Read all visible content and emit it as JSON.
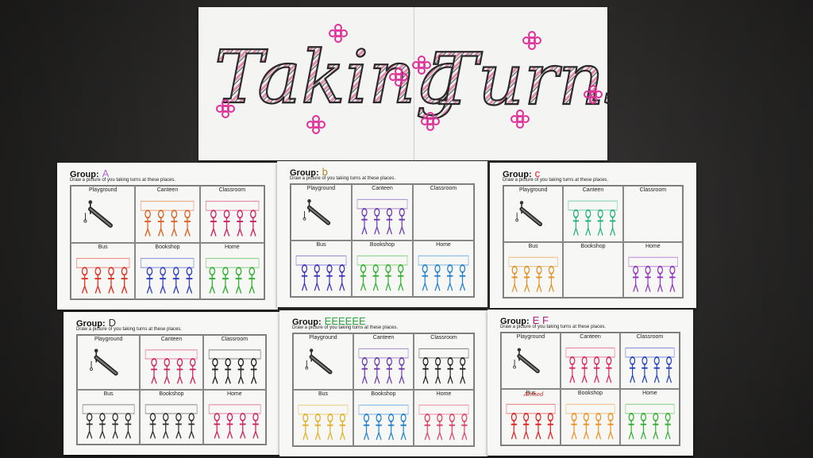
{
  "banner": {
    "title_word1": "Taking",
    "title_word2": "Turns"
  },
  "instruction": "Draw a picture of you taking turns at these places.",
  "group_label": "Group:",
  "places": [
    "Playground",
    "Canteen",
    "Classroom",
    "Bus",
    "Bookshop",
    "Home"
  ],
  "sheets": [
    {
      "group": "A",
      "mark_color": "#b06ad8",
      "drawings": {
        "Canteen": "#e06020",
        "Classroom": "#d02060",
        "Bus": "#e03020",
        "Bookshop": "#3040c0",
        "Home": "#30b030"
      }
    },
    {
      "group": "b",
      "mark_color": "#b08030",
      "drawings": {
        "Canteen": "#6a3ab0",
        "Bus": "#3a30c0",
        "Bookshop": "#30b030",
        "Home": "#2080d0"
      }
    },
    {
      "group": "c",
      "mark_color": "#e02020",
      "drawings": {
        "Canteen": "#20b080",
        "Bus": "#e09020",
        "Home": "#9030c0"
      }
    },
    {
      "group": "D",
      "mark_color": "#333333",
      "drawings": {
        "Canteen": "#d02060",
        "Classroom": "#202020",
        "Bus": "#303030",
        "Bookshop": "#303030",
        "Home": "#d02060"
      }
    },
    {
      "group": "EEEEEE",
      "mark_color": "#30a040",
      "drawings": {
        "Canteen": "#6a3ab0",
        "Classroom": "#202020",
        "Bus": "#e0b020",
        "Bookshop": "#2080d0",
        "Home": "#e04060"
      }
    },
    {
      "group": "E F",
      "mark_color": "#b02080",
      "drawings": {
        "Canteen": "#e02060",
        "Classroom": "#2040c0",
        "Bus": "#e02020",
        "Bookshop": "#f09020",
        "Home": "#30b030"
      }
    }
  ],
  "annotation_bus_ef": "Ahmed"
}
